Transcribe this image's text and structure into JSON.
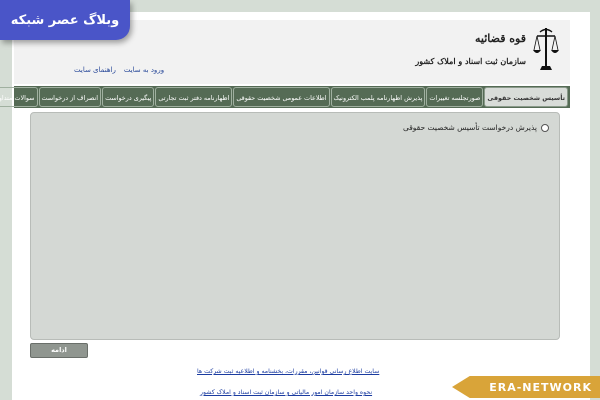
{
  "watermark": {
    "text": "وبلاگ عصر شبکه"
  },
  "logo": {
    "title": "قوه قضائیه",
    "subtitle": "سازمان ثبت اسناد و املاک کشور"
  },
  "header_links": {
    "enter_site": "ورود به سایت",
    "site_guide": "راهنمای سایت"
  },
  "nav": {
    "items": [
      "تأسیس شخصیت حقوقی",
      "صورتجلسه تغییرات",
      "پذیرش اظهارنامه پلمب الکترونیک",
      "اطلاعات عمومی شخصیت حقوقی",
      "اظهارنامه دفتر ثبت تجارتی",
      "پیگیری درخواست",
      "انصراف از درخواست",
      "سوالات متداول"
    ],
    "active_index": 0
  },
  "form": {
    "radio_label": "پذیرش درخواست تأسیس شخصیت حقوقی",
    "radio_checked": false,
    "continue_label": "ادامه"
  },
  "footer": {
    "link1": "سایت اطلاع رسانی قوانین، مقررات، بخشنامه و اطلاعیه ثبت شرکت ها",
    "link2": "نحوه واحد سازمان امور مالیاتی و سازمان ثبت اسناد و املاک کشور"
  },
  "era_badge": {
    "text": "ERA-NETWORK",
    "color": "#d9a439"
  },
  "colors": {
    "nav_bg": "#556b55",
    "panel_bg": "#d4d8d4",
    "link": "#1a3ba0"
  }
}
